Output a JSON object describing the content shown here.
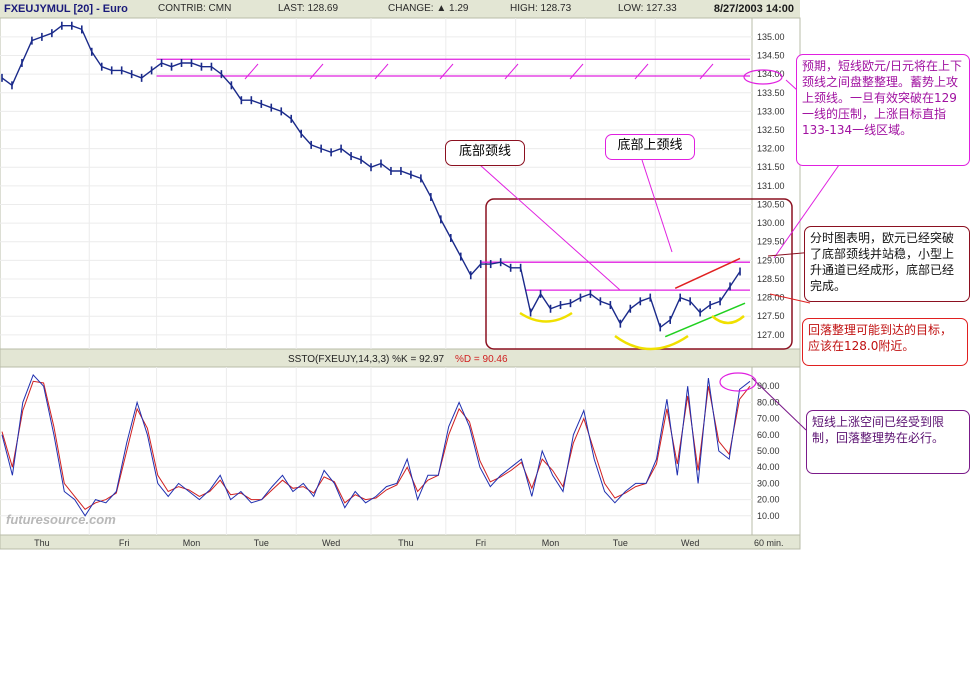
{
  "header": {
    "symbol": "FXEUJYMUL [20] - Euro",
    "contributor": "CONTRIB: CMN",
    "last": "LAST: 128.69",
    "change": "CHANGE: ▲ 1.29",
    "high": "HIGH: 128.73",
    "low": "LOW: 127.33",
    "datetime": "8/27/2003 14:00"
  },
  "stoch_header": {
    "label": "SSTO(FXEUJY,14,3,3) %K = 92.97",
    "d_label": "%D = 90.46"
  },
  "watermark": "futuresource.com",
  "interval_label": "60 min.",
  "colors": {
    "price": "#1a2a8a",
    "stoch_k": "#2030b0",
    "stoch_d": "#d02020",
    "magenta": "#e020e0",
    "annotation_border": "#8b1020",
    "red_line": "#e02020",
    "green_line": "#20d020",
    "yellow": "#f0e000"
  },
  "chart_data": [
    {
      "type": "line",
      "title": "FXEUJYMUL [20] - Euro",
      "x_labels": [
        "Thu",
        "Fri",
        "Mon",
        "Tue",
        "Wed",
        "Thu",
        "Fri",
        "Mon",
        "Tue",
        "Wed"
      ],
      "y_ticks": [
        "135.00",
        "134.50",
        "134.00",
        "133.50",
        "133.00",
        "132.50",
        "132.00",
        "131.50",
        "131.00",
        "130.50",
        "130.00",
        "129.50",
        "129.00",
        "128.50",
        "128.00",
        "127.50",
        "127.00"
      ],
      "ylim": [
        126.7,
        135.4
      ],
      "x_range": [
        0,
        150
      ],
      "reference_lines": [
        {
          "name": "upper channel",
          "y": 134.4,
          "x": [
            31,
            150
          ]
        },
        {
          "name": "lower channel",
          "y": 133.95,
          "x": [
            31,
            150
          ]
        },
        {
          "name": "bottom upper neckline",
          "y": 128.95,
          "x": [
            96,
            150
          ]
        },
        {
          "name": "bottom neckline",
          "y": 128.2,
          "x": [
            105,
            150
          ]
        }
      ],
      "trend_lines": [
        {
          "name": "rising channel top",
          "from": [
            135,
            128.25
          ],
          "to": [
            148,
            129.05
          ]
        },
        {
          "name": "rising channel bottom",
          "from": [
            133,
            126.95
          ],
          "to": [
            149,
            127.85
          ]
        }
      ],
      "price": [
        [
          0,
          133.9
        ],
        [
          2,
          133.7
        ],
        [
          4,
          134.3
        ],
        [
          6,
          134.9
        ],
        [
          8,
          135.0
        ],
        [
          10,
          135.1
        ],
        [
          12,
          135.3
        ],
        [
          14,
          135.3
        ],
        [
          16,
          135.2
        ],
        [
          18,
          134.6
        ],
        [
          20,
          134.2
        ],
        [
          22,
          134.1
        ],
        [
          24,
          134.1
        ],
        [
          26,
          134.0
        ],
        [
          28,
          133.9
        ],
        [
          30,
          134.1
        ],
        [
          32,
          134.3
        ],
        [
          34,
          134.2
        ],
        [
          36,
          134.3
        ],
        [
          38,
          134.3
        ],
        [
          40,
          134.2
        ],
        [
          42,
          134.2
        ],
        [
          44,
          134.0
        ],
        [
          46,
          133.7
        ],
        [
          48,
          133.3
        ],
        [
          50,
          133.3
        ],
        [
          52,
          133.2
        ],
        [
          54,
          133.1
        ],
        [
          56,
          133.0
        ],
        [
          58,
          132.8
        ],
        [
          60,
          132.4
        ],
        [
          62,
          132.1
        ],
        [
          64,
          132.0
        ],
        [
          66,
          131.9
        ],
        [
          68,
          132.0
        ],
        [
          70,
          131.8
        ],
        [
          72,
          131.7
        ],
        [
          74,
          131.5
        ],
        [
          76,
          131.6
        ],
        [
          78,
          131.4
        ],
        [
          80,
          131.4
        ],
        [
          82,
          131.3
        ],
        [
          84,
          131.2
        ],
        [
          86,
          130.7
        ],
        [
          88,
          130.1
        ],
        [
          90,
          129.6
        ],
        [
          92,
          129.1
        ],
        [
          94,
          128.6
        ],
        [
          96,
          128.9
        ],
        [
          98,
          128.9
        ],
        [
          100,
          128.95
        ],
        [
          102,
          128.8
        ],
        [
          104,
          128.8
        ],
        [
          106,
          127.6
        ],
        [
          108,
          128.1
        ],
        [
          110,
          127.7
        ],
        [
          112,
          127.8
        ],
        [
          114,
          127.85
        ],
        [
          116,
          128.0
        ],
        [
          118,
          128.1
        ],
        [
          120,
          127.9
        ],
        [
          122,
          127.8
        ],
        [
          124,
          127.3
        ],
        [
          126,
          127.7
        ],
        [
          128,
          127.9
        ],
        [
          130,
          128.0
        ],
        [
          132,
          127.2
        ],
        [
          134,
          127.4
        ],
        [
          136,
          128.0
        ],
        [
          138,
          127.9
        ],
        [
          140,
          127.6
        ],
        [
          142,
          127.8
        ],
        [
          144,
          127.9
        ],
        [
          146,
          128.3
        ],
        [
          148,
          128.7
        ]
      ],
      "annotations": [
        "底部颈线",
        "底部上颈线"
      ]
    },
    {
      "type": "line",
      "title": "SSTO(FXEUJY,14,3,3)",
      "y_ticks": [
        "90.00",
        "80.00",
        "70.00",
        "60.00",
        "50.00",
        "40.00",
        "30.00",
        "20.00",
        "10.00"
      ],
      "ylim": [
        0,
        100
      ],
      "x_range": [
        0,
        150
      ],
      "series": [
        {
          "name": "%K",
          "values": [
            60,
            35,
            80,
            97,
            90,
            60,
            25,
            20,
            10,
            20,
            18,
            25,
            55,
            80,
            60,
            30,
            22,
            30,
            25,
            20,
            26,
            35,
            20,
            25,
            18,
            20,
            28,
            35,
            25,
            30,
            22,
            38,
            30,
            15,
            25,
            18,
            22,
            28,
            30,
            45,
            20,
            35,
            35,
            65,
            80,
            65,
            40,
            28,
            35,
            40,
            45,
            22,
            50,
            35,
            25,
            60,
            75,
            45,
            25,
            18,
            25,
            30,
            30,
            45,
            82,
            35,
            90,
            30,
            95,
            50,
            45,
            88,
            93
          ]
        },
        {
          "name": "%D",
          "values": [
            62,
            40,
            75,
            93,
            92,
            65,
            30,
            22,
            14,
            18,
            20,
            24,
            50,
            76,
            64,
            35,
            25,
            28,
            26,
            22,
            25,
            32,
            23,
            24,
            20,
            20,
            26,
            32,
            27,
            28,
            24,
            34,
            31,
            18,
            23,
            20,
            21,
            26,
            29,
            40,
            25,
            32,
            35,
            60,
            76,
            68,
            44,
            31,
            34,
            38,
            43,
            27,
            45,
            38,
            28,
            55,
            70,
            50,
            30,
            21,
            24,
            28,
            30,
            42,
            76,
            42,
            84,
            38,
            90,
            56,
            48,
            82,
            90
          ]
        }
      ]
    }
  ],
  "notes": {
    "neckline_label": "底部颈线",
    "upper_neckline_label": "底部上颈线",
    "forecast": "预期，短线欧元/日元将在上下颈线之间盘整整理。蓄势上攻上颈线。一旦有效突破在129一线的压制，上涨目标直指133-134一线区域。",
    "hourly": "分时图表明，欧元已经突破了底部颈线并站稳，小型上升通道已经成形，底部已经完成。",
    "retrace": "回落整理可能到达的目标，应该在128.0附近。",
    "stoch": "短线上涨空间已经受到限制，回落整理势在必行。"
  }
}
